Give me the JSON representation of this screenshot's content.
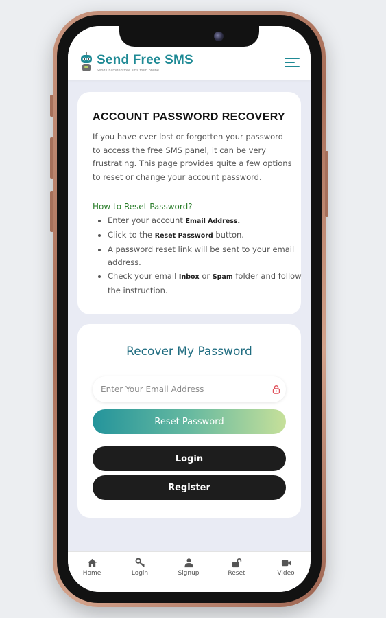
{
  "header": {
    "brand_name": "Send Free SMS",
    "brand_tagline": "Send unlimited free sms from online..."
  },
  "recovery_info": {
    "title": "ACCOUNT PASSWORD RECOVERY",
    "intro": "If you have ever lost or forgotten your password to access the free SMS panel, it can be very frustrating. This page provides quite a few options to reset or change your account password.",
    "howto_heading": "How to Reset Password?",
    "steps": [
      {
        "before": "Enter your account ",
        "bold": "Email Address.",
        "after": ""
      },
      {
        "before": "Click to the ",
        "bold": "Reset Password",
        "after": " button."
      },
      {
        "before": "A password reset link will be sent to your email address.",
        "bold": "",
        "after": ""
      },
      {
        "before": "Check your email ",
        "bold": "Inbox",
        "after": " or ",
        "bold2": "Spam",
        "after2": " folder and follow the instruction."
      }
    ]
  },
  "form": {
    "title": "Recover My Password",
    "email_placeholder": "Enter Your Email Address",
    "email_value": "",
    "reset_label": "Reset Password",
    "login_label": "Login",
    "register_label": "Register"
  },
  "bottom_nav": [
    {
      "label": "Home",
      "icon": "home-icon"
    },
    {
      "label": "Login",
      "icon": "key-icon"
    },
    {
      "label": "Signup",
      "icon": "user-icon"
    },
    {
      "label": "Reset",
      "icon": "unlock-icon"
    },
    {
      "label": "Video",
      "icon": "video-icon"
    }
  ],
  "colors": {
    "brand": "#1f8a95",
    "howto_heading": "#2a7d2a",
    "form_title": "#1f6c80",
    "reset_gradient_start": "#24949b",
    "reset_gradient_end": "#c6e09a",
    "dark_button": "#1d1d1d",
    "lock_icon": "#e0505a"
  }
}
